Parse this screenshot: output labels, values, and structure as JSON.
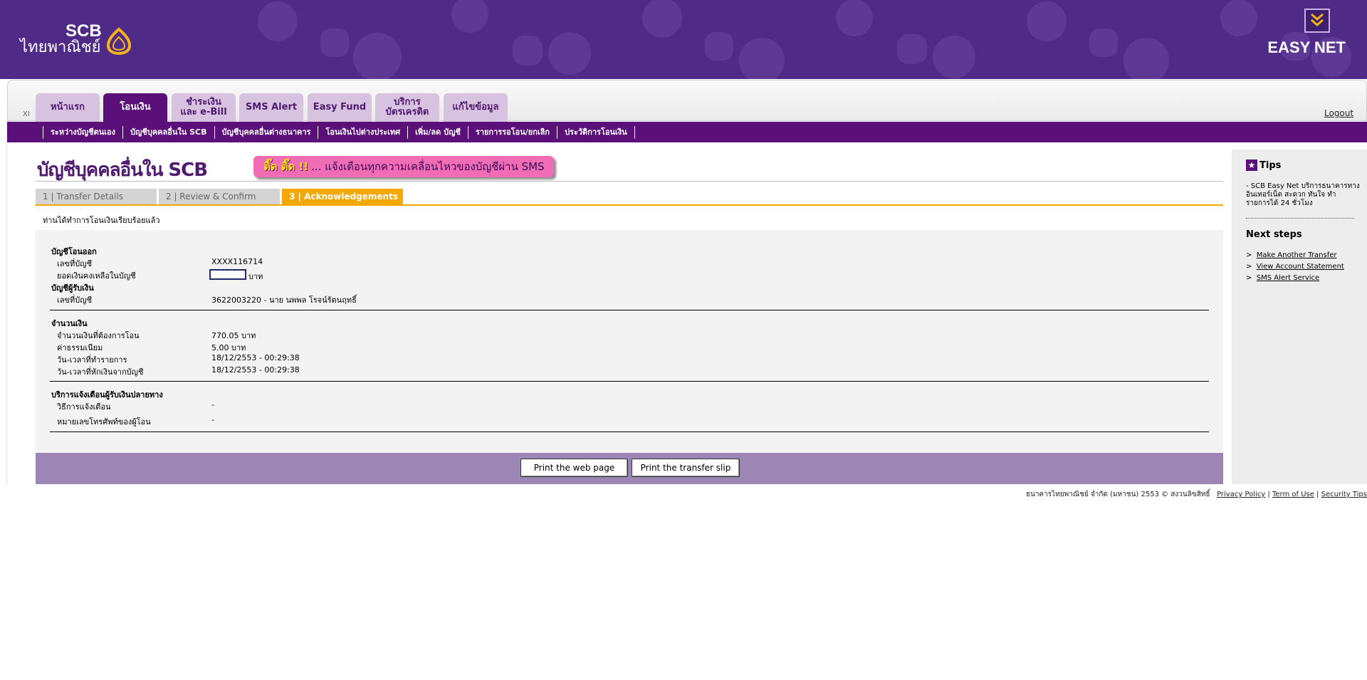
{
  "header": {
    "logo_scb": "SCB",
    "logo_thai": "ไทยพาณิชย์",
    "product": "EASY NET"
  },
  "nav": {
    "tabs": [
      {
        "label": "หน้าแรก"
      },
      {
        "label": "โอนเงิน",
        "active": true
      },
      {
        "label": "ชำระเงิน\nและ e-Bill"
      },
      {
        "label": "SMS Alert"
      },
      {
        "label": "Easy Fund"
      },
      {
        "label": "บริการ\nบัตรเครดิต"
      },
      {
        "label": "แก้ไขข้อมูล"
      }
    ],
    "logout": "Logout",
    "xi": "XI"
  },
  "subnav": {
    "items": [
      "ระหว่างบัญชีตนเอง",
      "บัญชีบุคคลอื่นใน SCB",
      "บัญชีบุคคลอื่นต่างธนาคาร",
      "โอนเงินไปต่างประเทศ",
      "เพิ่ม/ลด บัญชี",
      "รายการรอโอน/ยกเลิก",
      "ประวัติการโอนเงิน"
    ]
  },
  "page": {
    "title": "บัญชีบุคคลอื่นใน SCB",
    "sms_banner_highlight": "ติ๊ด ติ๊ด !!",
    "sms_banner_text": "... แจ้งเตือนทุกความเคลื่อนไหวของบัญชีผ่าน SMS",
    "steps": [
      "1 | Transfer Details",
      "2 | Review & Confirm",
      "3 | Acknowledgements"
    ],
    "active_step": 3,
    "done_message": "ท่านได้ทำการโอนเงินเรียบร้อยแล้ว"
  },
  "details": {
    "from_section": "บัญชีโอนออก",
    "from_account_label": "เลขที่บัญชี",
    "from_account_value": "XXXX116714",
    "balance_label": "ยอดเงินคงเหลือในบัญชี",
    "balance_unit": "บาท",
    "to_section": "บัญชีผู้รับเงิน",
    "to_account_label": "เลขที่บัญชี",
    "to_account_value": "3622003220 - นาย นพพล โรจน์รัตนฤทธิ์",
    "amount_section": "จำนวนเงิน",
    "amount_label": "จำนวนเงินที่ต้องการโอน",
    "amount_value": "770.05 บาท",
    "fee_label": "ค่าธรรมเนียม",
    "fee_value": "5.00 บาท",
    "txn_time_label": "วัน-เวลาที่ทำรายการ",
    "txn_time_value": "18/12/2553 - 00:29:38",
    "debit_time_label": "วัน-เวลาที่หักเงินจากบัญชี",
    "debit_time_value": "18/12/2553 - 00:29:38",
    "notify_section": "บริการแจ้งเตือนผู้รับเงินปลายทาง",
    "notify_method_label": "วิธีการแจ้งเตือน",
    "notify_method_value": "-",
    "phone_label": "หมายเลขโทรศัพท์ของผู้โอน",
    "phone_value": "-"
  },
  "actions": {
    "print_page": "Print the web page",
    "print_slip": "Print the transfer slip"
  },
  "sidebar": {
    "tips_title": "Tips",
    "tips_text": "- SCB Easy Net บริการธนาคารทางอินเทอร์เน็ต สะดวก ทันใจ ทำรายการได้ 24 ชั่วโมง",
    "next_title": "Next steps",
    "next_links": [
      "Make Another Transfer",
      "View Account Statement",
      "SMS Alert Service"
    ]
  },
  "footer": {
    "copyright": "ธนาคารไทยพาณิชย์ จำกัด (มหาชน) 2553 © สงวนลิขสิทธิ์",
    "privacy": "Privacy Policy",
    "terms": "Term of Use",
    "security": "Security Tips"
  },
  "colors": {
    "brand_purple": "#4f2a86",
    "nav_purple": "#5b0f78",
    "step_orange": "#f6a800",
    "action_bar": "#9c86b5"
  }
}
